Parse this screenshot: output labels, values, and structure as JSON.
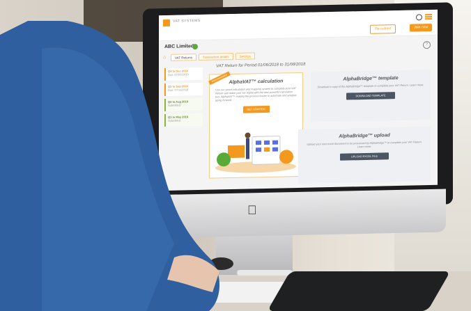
{
  "app": {
    "brand": "VAT SYSTEMS",
    "company": "ABC Limited",
    "help": "?",
    "buttons": {
      "resubmit": "Re-submit",
      "join": "Join now"
    }
  },
  "tabs": [
    {
      "label": "VAT Returns"
    },
    {
      "label": "Transaction details"
    },
    {
      "label": "Settings"
    }
  ],
  "periods": [
    {
      "title": "Q4 to Dec 2018",
      "sub": "Due: 07/02/2019",
      "status": "due"
    },
    {
      "title": "Q3 to Sep 2018",
      "sub": "Due: 07/11/2018",
      "status": "due"
    },
    {
      "title": "Q2 to Aug 2018",
      "sub": "Submitted",
      "status": "submitted"
    },
    {
      "title": "Q1 to May 2018",
      "sub": "Submitted",
      "status": "submitted"
    }
  ],
  "period_heading": "VAT Return for Period 01/06/2018 to 31/08/2018",
  "calc_card": {
    "ribbon": "Recommended",
    "title": "AlphaVAT™ calculation",
    "desc": "Use our smart calculation and mapping system to complete your VAT Return and make your tax digital with the new powerful calculation tool. AlphaVAT™ making the process easier to automate and analyse going forward.",
    "button": "GET STARTED"
  },
  "template_card": {
    "title": "AlphaBridge™ template",
    "desc": "Download a copy of the AlphaBridge™ template to complete your VAT Return. Learn more.",
    "button": "DOWNLOAD TEMPLATE"
  },
  "upload_card": {
    "title": "AlphaBridge™ upload",
    "desc": "Upload your own excel document to be processed by AlphaBridge™ to complete your VAT Return. Learn more.",
    "button": "UPLOAD EXCEL FILE"
  }
}
